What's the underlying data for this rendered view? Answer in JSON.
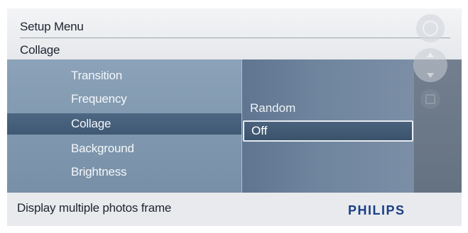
{
  "header": {
    "title": "Setup Menu",
    "subtitle": "Collage"
  },
  "menu": {
    "items": [
      {
        "label": "Transition",
        "selected": false
      },
      {
        "label": "Frequency",
        "selected": false
      },
      {
        "label": "Collage",
        "selected": true
      },
      {
        "label": "Background",
        "selected": false
      },
      {
        "label": "Brightness",
        "selected": false
      }
    ]
  },
  "options": {
    "items": [
      {
        "label": "Random",
        "selected": false
      },
      {
        "label": "Off",
        "selected": true
      }
    ]
  },
  "footer": {
    "description": "Display multiple photos frame",
    "brand": "PHILIPS"
  },
  "icons": [
    "menu-icon",
    "nav-pad-icon",
    "slideshow-icon"
  ],
  "colors": {
    "panel": "#7f97ae",
    "selection": "#4a627c",
    "brand": "#1b3f86"
  }
}
